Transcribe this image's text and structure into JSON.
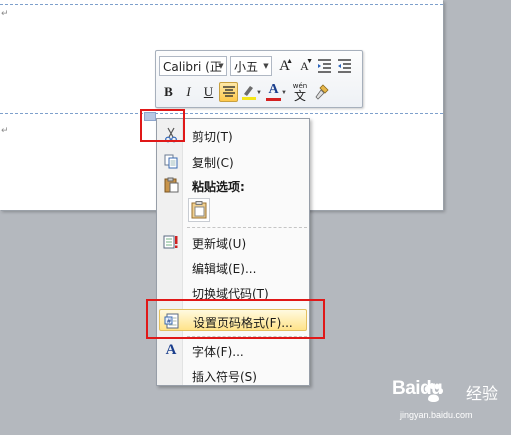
{
  "toolbar": {
    "font_name": "Calibri (正",
    "font_size": "小五",
    "grow_font_icon": "A",
    "shrink_font_icon": "A",
    "bold": "B",
    "italic": "I",
    "underline": "U",
    "font_color_icon": "A",
    "phonetic_top": "wén",
    "phonetic_char": "文"
  },
  "menu": {
    "items": [
      {
        "label": "剪切(T)",
        "icon": "scissors-icon"
      },
      {
        "label": "复制(C)",
        "icon": "copy-icon"
      },
      {
        "label": "粘贴选项:",
        "icon": "clipboard-icon"
      },
      {
        "label": "更新域(U)",
        "icon": "update-field-icon"
      },
      {
        "label": "编辑域(E)...",
        "icon": ""
      },
      {
        "label": "切换域代码(T)",
        "icon": ""
      },
      {
        "label": "设置页码格式(F)...",
        "icon": "page-number-format-icon"
      },
      {
        "label": "字体(F)...",
        "icon": "font-icon"
      },
      {
        "label": "插入符号(S)",
        "icon": ""
      }
    ],
    "highlighted": "设置页码格式(F)..."
  },
  "watermark": {
    "brand": "Baidu",
    "brand_cn": "经验",
    "url": "jingyan.baidu.com"
  },
  "colors": {
    "highlight": "#ffe38a",
    "annotation": "#e01818",
    "font_color": "#d42020",
    "highlighter": "#f5e61a"
  }
}
